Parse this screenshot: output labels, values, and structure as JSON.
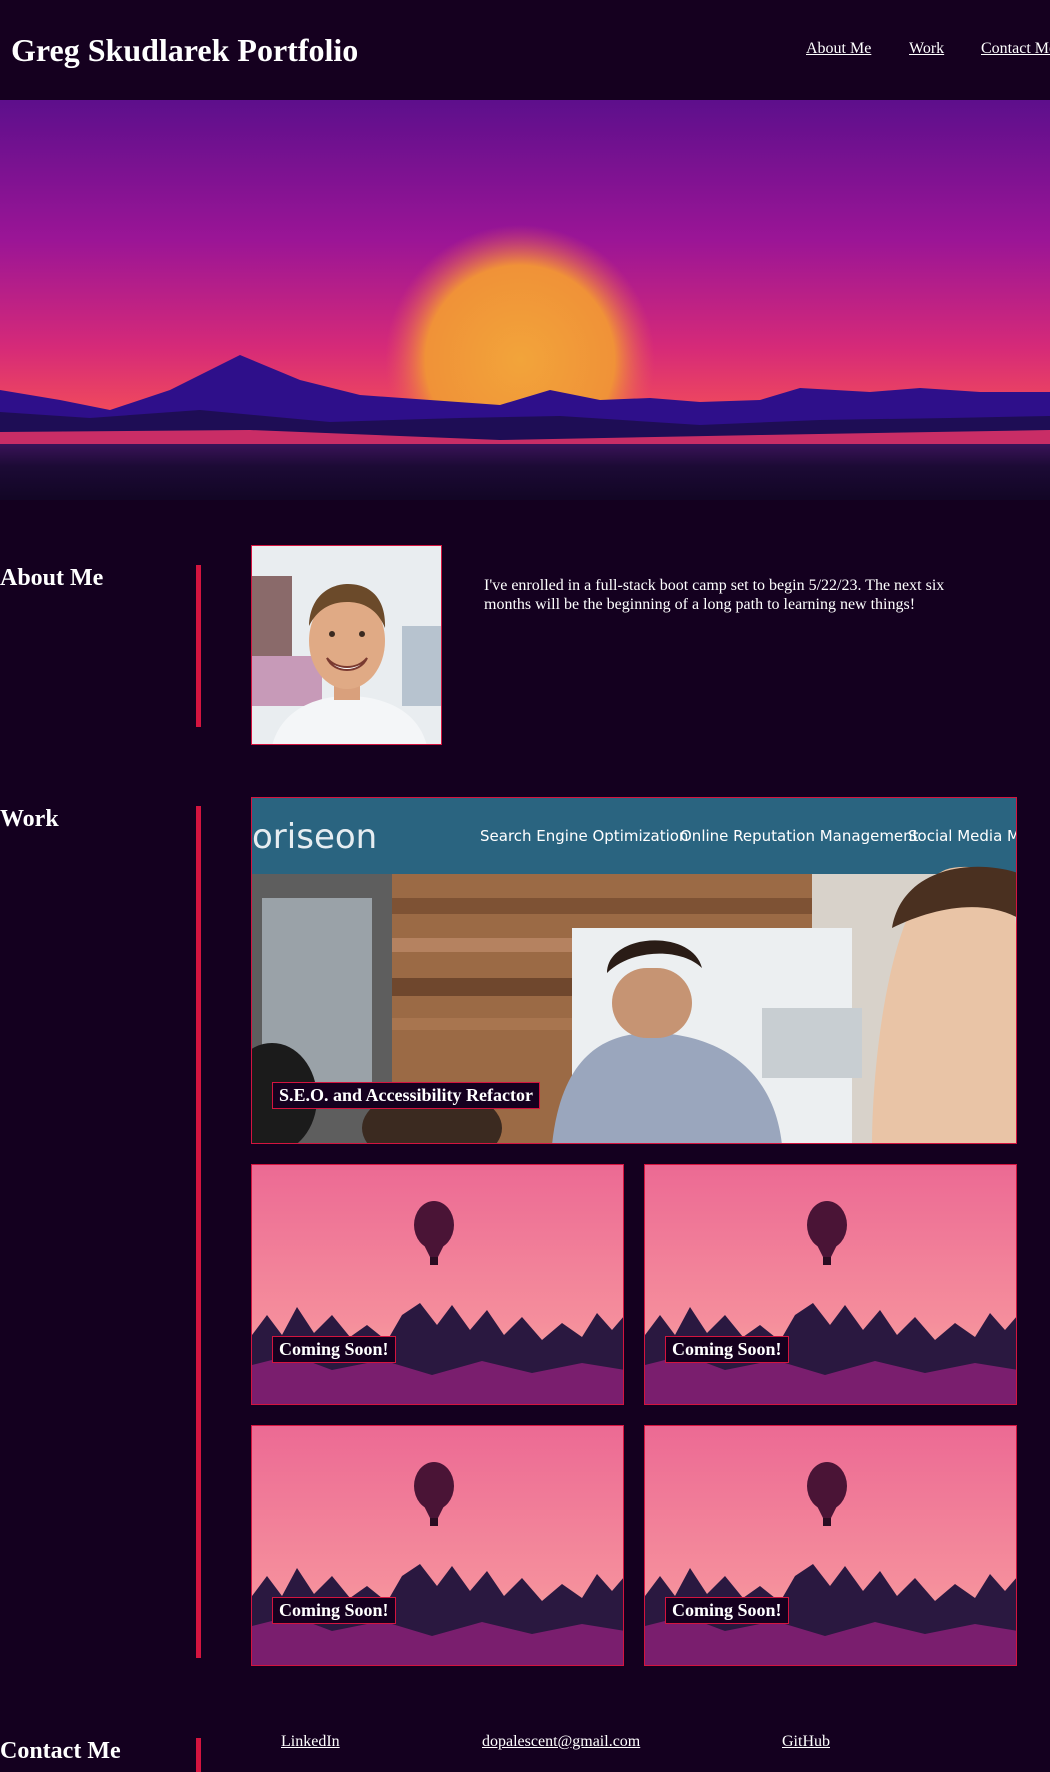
{
  "header": {
    "title": "Greg Skudlarek Portfolio",
    "nav": [
      "About Me",
      "Work",
      "Contact Me"
    ]
  },
  "hero": {
    "image": "sunset-mountains-hero"
  },
  "about": {
    "heading": "About Me",
    "text": "I've enrolled in a full-stack boot camp set to begin 5/22/23. The next six months will be the beginning of a long path to learning new things!"
  },
  "work": {
    "heading": "Work",
    "featured": {
      "label": "S.E.O. and Accessibility Refactor",
      "screenshot": {
        "logo": "oriseon",
        "nav": [
          "Search Engine Optimization",
          "Online Reputation Management",
          "Social Media Marketing"
        ]
      }
    },
    "projects": [
      {
        "label": "Coming Soon!"
      },
      {
        "label": "Coming Soon!"
      },
      {
        "label": "Coming Soon!"
      },
      {
        "label": "Coming Soon!"
      }
    ]
  },
  "contact": {
    "heading": "Contact Me",
    "links": [
      "LinkedIn",
      "dopalescent@gmail.com",
      "GitHub"
    ]
  },
  "colors": {
    "background": "#14001f",
    "accent": "#d4143f",
    "text": "#ffffff"
  }
}
